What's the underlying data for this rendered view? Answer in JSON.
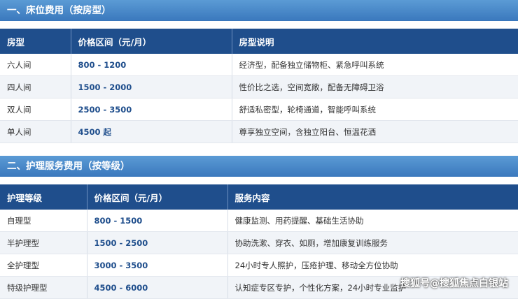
{
  "section1": {
    "title": "一、床位费用（按房型）",
    "headers": [
      "房型",
      "价格区间（元/月）",
      "房型说明"
    ],
    "rows": [
      [
        "六人间",
        "800 - 1200",
        "经济型，配备独立储物柜、紧急呼叫系统"
      ],
      [
        "四人间",
        "1500 - 2000",
        "性价比之选，空间宽敞，配备无障碍卫浴"
      ],
      [
        "双人间",
        "2500 - 3500",
        "舒适私密型，轮椅通道，智能呼叫系统"
      ],
      [
        "单人间",
        "4500 起",
        "尊享独立空间，含独立阳台、恒温花洒"
      ]
    ]
  },
  "section2": {
    "title": "二、护理服务费用（按等级）",
    "headers": [
      "护理等级",
      "价格区间（元/月）",
      "服务内容"
    ],
    "rows": [
      [
        "自理型",
        "800 - 1500",
        "健康监测、用药提醒、基础生活协助"
      ],
      [
        "半护理型",
        "1500 - 2500",
        "协助洗漱、穿衣、如厕，增加康复训练服务"
      ],
      [
        "全护理型",
        "3000 - 3500",
        "24小时专人照护，压疮护理、移动全方位协助"
      ],
      [
        "特级护理型",
        "4500 - 6000",
        "认知症专区专护，个性化方案，24小时专业监护"
      ]
    ]
  },
  "watermark": "搜狐号@搜狐焦点白银站"
}
